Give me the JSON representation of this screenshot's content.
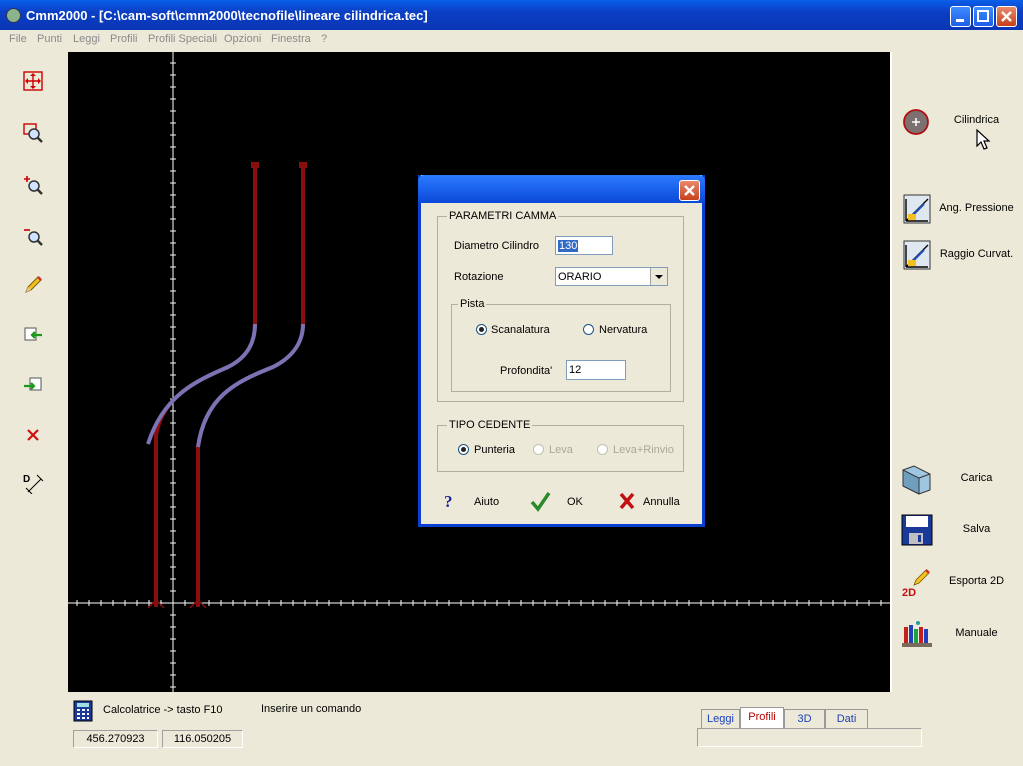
{
  "window": {
    "title": "Cmm2000 - [C:\\cam-soft\\cmm2000\\tecnofile\\lineare cilindrica.tec]"
  },
  "menu": [
    "File",
    "Punti",
    "Leggi",
    "Profili",
    "Profili Speciali",
    "Opzioni",
    "Finestra",
    "?"
  ],
  "left_toolbar": [
    "move-icon",
    "zoom-window-icon",
    "zoom-in-icon",
    "zoom-out-icon",
    "pencil-icon",
    "import-icon",
    "export-icon",
    "delete-icon",
    "dimension-icon"
  ],
  "right_toolbar": {
    "cilindrica": "Cilindrica",
    "ang_pressione": "Ang. Pressione",
    "raggio_curvat": "Raggio Curvat.",
    "carica": "Carica",
    "salva": "Salva",
    "esporta2d": "Esporta 2D",
    "esporta2d_badge": "2D",
    "manuale": "Manuale"
  },
  "dialog": {
    "group_camma": "PARAMETRI CAMMA",
    "diametro_label": "Diametro Cilindro",
    "diametro_value": "130",
    "rotazione_label": "Rotazione",
    "rotazione_value": "ORARIO",
    "group_pista": "Pista",
    "scanalatura": "Scanalatura",
    "nervatura": "Nervatura",
    "profondita_label": "Profondita'",
    "profondita_value": "12",
    "group_cedente": "TIPO CEDENTE",
    "punteria": "Punteria",
    "leva": "Leva",
    "leva_rinvio": "Leva+Rinvio",
    "aiuto": "Aiuto",
    "ok": "OK",
    "annulla": "Annulla"
  },
  "status": {
    "calc_label": "Calcolatrice -> tasto F10",
    "command": "Inserire un comando",
    "coord_x": "456.270923",
    "coord_y": "116.050205"
  },
  "tabs": [
    "Leggi",
    "Profili",
    "3D",
    "Dati"
  ],
  "active_tab": "Profili",
  "colors": {
    "profile": "#8b0d0d",
    "transition": "#7a73b5",
    "axis": "#ffffff",
    "title": "#0b48d8"
  }
}
